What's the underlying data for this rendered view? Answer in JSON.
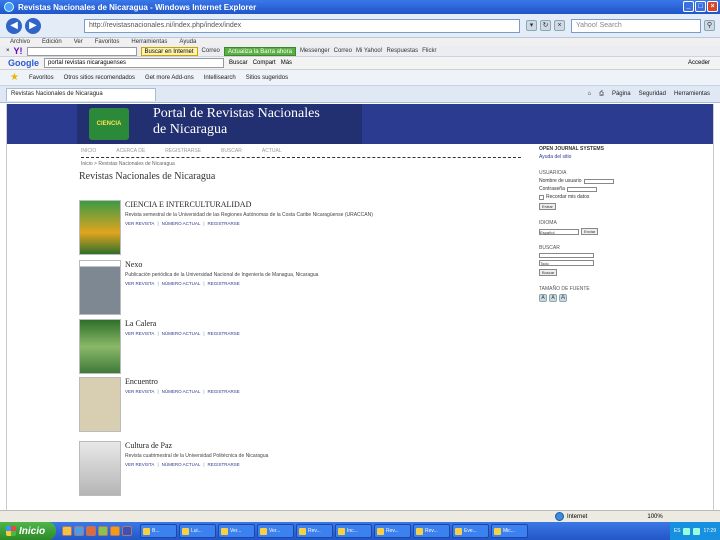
{
  "window": {
    "title": "Revistas Nacionales de Nicaragua - Windows Internet Explorer",
    "buttons": {
      "minimize": "_",
      "maximize": "□",
      "close": "×"
    }
  },
  "address": {
    "url": "http://revistasnacionales.ni/index.php/index/index",
    "search_placeholder": "Yahoo! Search"
  },
  "menu": [
    "Archivo",
    "Edición",
    "Ver",
    "Favoritos",
    "Herramientas",
    "Ayuda"
  ],
  "yahoo_toolbar": {
    "logo": "Y!",
    "search_button": "Buscar en Internet",
    "items": [
      "Correo",
      "Actualizar Barra"
    ],
    "green_button": "Actualiza la Barra ahora",
    "more_items": [
      "Messenger",
      "Correo",
      "Mi Yahoo!",
      "Respuestas",
      "Flickr"
    ]
  },
  "google_toolbar": {
    "logo": "Google",
    "query": "portal revistas nicaraguenses",
    "items": [
      "Buscar",
      "Compart",
      "Más",
      "Acceder"
    ]
  },
  "favorites_bar": {
    "label": "Favoritos",
    "items": [
      "Otros sitios recomendados",
      "Get more Add-ons",
      "Intellisearch",
      "Sitios sugeridos"
    ]
  },
  "tabs": {
    "active": "Revistas Nacionales de Nicaragua",
    "commands": [
      "Página",
      "Seguridad",
      "Herramientas"
    ]
  },
  "page": {
    "banner_logo_text": "CIENCIA",
    "banner_title_line1": "Portal de Revistas Nacionales",
    "banner_title_line2": "de Nicaragua",
    "subnav": [
      "INICIO",
      "ACERCA DE",
      "REGISTRARSE",
      "BUSCAR",
      "ACTUAL"
    ],
    "breadcrumb": "Inicio > Revistas Nacionales de Nicaragua",
    "heading": "Revistas Nacionales de Nicaragua",
    "journals": [
      {
        "title": "CIENCIA E INTERCULTURALIDAD",
        "description": "Revista semestral de la Universidad de las Regiones Autónomas de la Costa Caribe Nicaragüense (URACCAN)",
        "links": [
          "VER REVISTA",
          "NÚMERO ACTUAL",
          "REGISTRARSE"
        ],
        "cover_color": "#2f8f3d"
      },
      {
        "title": "Nexo",
        "description": "Publicación periódica de la Universidad Nacional de Ingeniería de Managua, Nicaragua",
        "links": [
          "VER REVISTA",
          "NÚMERO ACTUAL",
          "REGISTRARSE"
        ],
        "cover_color": "#7d8893"
      },
      {
        "title": "La Calera",
        "description": "",
        "links": [
          "VER REVISTA",
          "NÚMERO ACTUAL",
          "REGISTRARSE"
        ],
        "cover_color": "#5a8f3a"
      },
      {
        "title": "Encuentro",
        "description": "",
        "links": [
          "VER REVISTA",
          "NÚMERO ACTUAL",
          "REGISTRARSE"
        ],
        "cover_color": "#c9bfa4"
      },
      {
        "title": "Cultura de Paz",
        "description": "Revista cuatrimestral de la Universidad Politécnica de Nicaragua",
        "links": [
          "VER REVISTA",
          "NÚMERO ACTUAL",
          "REGISTRARSE"
        ],
        "cover_color": "#d9d9d9"
      }
    ]
  },
  "sidebar": {
    "heading": "OPEN JOURNAL SYSTEMS",
    "help_link": "Ayuda del sitio",
    "user_label": "USUARIO/A",
    "username_label": "Nombre de usuario",
    "password_label": "Contraseña",
    "remember_label": "Recordar mis datos",
    "login_button": "Entrar",
    "language_label": "IDIOMA",
    "language_value": "Español",
    "language_button": "Enviar",
    "search_label": "BUSCAR",
    "search_scope": "Todo",
    "search_button": "Buscar",
    "font_size_label": "TAMAÑO DE FUENTE"
  },
  "status": {
    "zone": "Internet",
    "zoom": "100%"
  },
  "taskbar": {
    "start": "Inicio",
    "items": [
      "B...",
      "Lui...",
      "Ver...",
      "Ver...",
      "Rev...",
      "Inc...",
      "Rev...",
      "Rev...",
      "Eve...",
      "Mic...",
      "Lui..."
    ],
    "lang": "ES",
    "clock": "17:29"
  },
  "colors": {
    "banner": "#2b3b8f",
    "link": "#2b3b8f"
  }
}
